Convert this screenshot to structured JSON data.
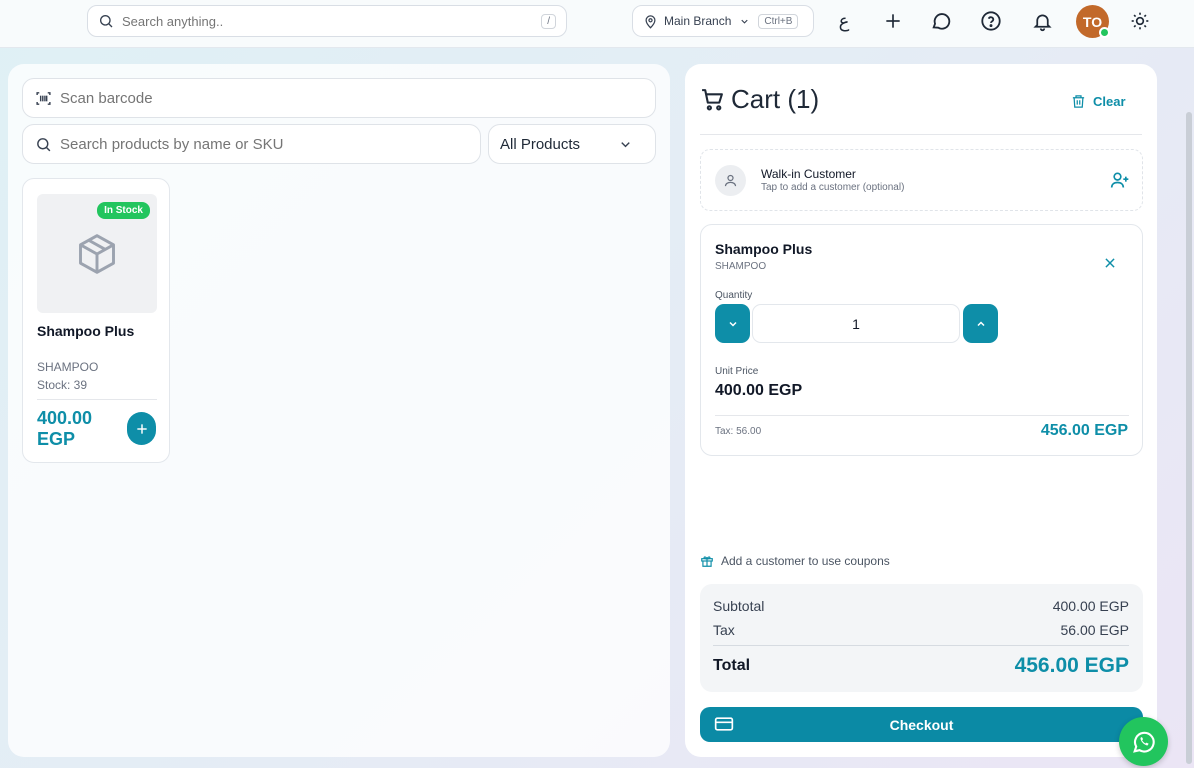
{
  "topbar": {
    "search_placeholder": "Search anything..",
    "search_shortcut": "/",
    "branch_label": "Main Branch",
    "branch_shortcut": "Ctrl+B",
    "language_label": "ع",
    "avatar_initials": "TO"
  },
  "products": {
    "scan_placeholder": "Scan barcode",
    "search_placeholder": "Search products by name or SKU",
    "filter_selected": "All Products",
    "items": [
      {
        "name": "Shampoo Plus",
        "badge": "In Stock",
        "sku": "SHAMPOO",
        "stock": "Stock: 39",
        "price": "400.00 EGP"
      }
    ]
  },
  "cart": {
    "title": "Cart (1)",
    "clear_label": "Clear",
    "customer": {
      "name": "Walk-in Customer",
      "hint": "Tap to add a customer (optional)"
    },
    "items": [
      {
        "name": "Shampoo Plus",
        "sku": "SHAMPOO",
        "quantity_label": "Quantity",
        "quantity": "1",
        "unit_price_label": "Unit Price",
        "unit_price": "400.00 EGP",
        "tax": "Tax: 56.00",
        "line_total": "456.00 EGP"
      }
    ],
    "coupon_hint": "Add a customer to use coupons",
    "summary": {
      "subtotal_label": "Subtotal",
      "subtotal": "400.00 EGP",
      "tax_label": "Tax",
      "tax": "56.00 EGP",
      "total_label": "Total",
      "total": "456.00 EGP"
    },
    "checkout_label": "Checkout"
  },
  "colors": {
    "accent": "#0e8ea8",
    "in_stock": "#22c55e",
    "avatar": "#c2692a",
    "whatsapp": "#22c55e"
  }
}
